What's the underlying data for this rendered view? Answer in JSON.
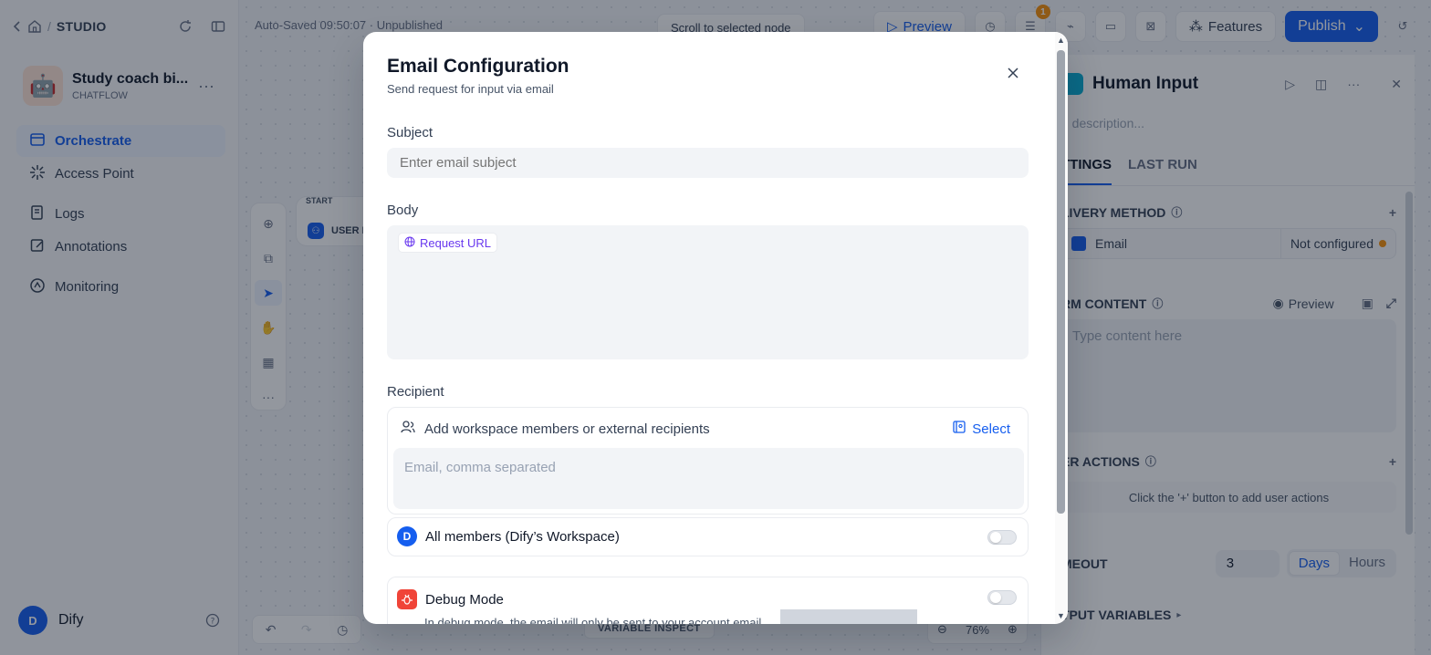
{
  "studio": {
    "crumb": "STUDIO"
  },
  "app": {
    "name": "Study coach bi...",
    "type": "CHATFLOW",
    "avatar": "🤖"
  },
  "nav": [
    {
      "label": "Orchestrate",
      "icon": "orchestrate-icon",
      "active": true
    },
    {
      "label": "Access Point",
      "icon": "access-point-icon",
      "active": false
    },
    {
      "label": "Logs",
      "icon": "logs-icon",
      "active": false
    },
    {
      "label": "Annotations",
      "icon": "annotations-icon",
      "active": false
    },
    {
      "label": "Monitoring",
      "icon": "monitoring-icon",
      "active": false
    }
  ],
  "user": {
    "initial": "D",
    "name": "Dify"
  },
  "topbar": {
    "status": "Auto-Saved 09:50:07 · Unpublished",
    "scroll_to_selected": "Scroll to selected node",
    "preview": "Preview",
    "badge_count": "1",
    "features": "Features",
    "publish": "Publish"
  },
  "canvas": {
    "start_label": "START",
    "start_node": "USER IN",
    "variable_inspect": "VARIABLE INSPECT",
    "zoom": "76%"
  },
  "right_panel": {
    "title": "Human Input",
    "description_placeholder": "d description...",
    "tabs": [
      "TTINGS",
      "LAST RUN"
    ],
    "delivery_method_label": "LIVERY METHOD",
    "delivery_item": "Email",
    "delivery_status": "Not configured",
    "form_content_label": "RM CONTENT",
    "form_preview": "Preview",
    "form_placeholder": "Type content here",
    "user_actions_label": "ER ACTIONS",
    "user_actions_hint": "Click the '+' button to add user actions",
    "timeout_label": "MEOUT",
    "timeout_value": "3",
    "timeout_units": [
      "Days",
      "Hours"
    ],
    "output_variables_label": "TPUT VARIABLES"
  },
  "modal": {
    "title": "Email Configuration",
    "subtitle": "Send request for input via email",
    "subject_label": "Subject",
    "subject_placeholder": "Enter email subject",
    "body_label": "Body",
    "request_url_chip": "Request URL",
    "recipient_label": "Recipient",
    "recipient_add_text": "Add workspace members or external recipients",
    "recipient_select": "Select",
    "recipient_placeholder": "Email, comma separated",
    "all_members_initial": "D",
    "all_members_label": "All members (Dify’s Workspace)",
    "debug_mode_label": "Debug Mode",
    "debug_mode_desc": "In debug mode, the email will only be sent to your account email"
  }
}
